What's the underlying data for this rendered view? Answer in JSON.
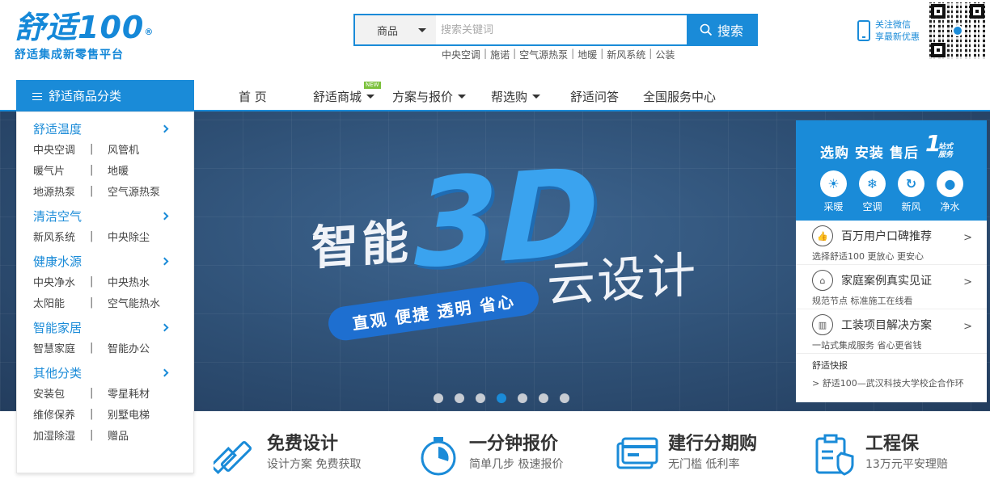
{
  "logo": {
    "main": "舒适100",
    "reg": "®",
    "slogan": "舒适集成新零售平台"
  },
  "search": {
    "category": "商品",
    "placeholder": "搜索关键词",
    "button": "搜索",
    "hot_links": [
      "中央空调",
      "施诺",
      "空气源热泵",
      "地暖",
      "新风系统",
      "公装"
    ]
  },
  "wechat": {
    "line1": "关注微信",
    "line2": "享最新优惠"
  },
  "nav": {
    "category_label": "舒适商品分类",
    "items": [
      "首 页",
      "舒适商城",
      "方案与报价",
      "帮选购",
      "舒适问答",
      "全国服务中心"
    ],
    "new_badge": "NEW"
  },
  "categories": [
    {
      "title": "舒适温度",
      "rows": [
        [
          "中央空调",
          "风管机"
        ],
        [
          "暖气片",
          "地暖"
        ],
        [
          "地源热泵",
          "空气源热泵"
        ]
      ]
    },
    {
      "title": "清洁空气",
      "rows": [
        [
          "新风系统",
          "中央除尘"
        ]
      ]
    },
    {
      "title": "健康水源",
      "rows": [
        [
          "中央净水",
          "中央热水"
        ],
        [
          "太阳能",
          "空气能热水"
        ]
      ]
    },
    {
      "title": "智能家居",
      "rows": [
        [
          "智慧家庭",
          "智能办公"
        ]
      ]
    },
    {
      "title": "其他分类",
      "rows": [
        [
          "安装包",
          "零星耗材"
        ],
        [
          "维修保养",
          "别墅电梯"
        ],
        [
          "加湿除湿",
          "赠品"
        ]
      ]
    }
  ],
  "banner": {
    "word1": "智能",
    "word2": "3D",
    "word3": "云设计",
    "pill": "直观 便捷 透明 省心",
    "dot_count": 7,
    "active_dot": 4
  },
  "right_panel": {
    "title": "选购 安装 售后",
    "badge_one": "1",
    "badge_l1": "站式",
    "badge_l2": "服务",
    "icons": [
      "采暖",
      "空调",
      "新风",
      "净水"
    ],
    "items": [
      {
        "title": "百万用户口碑推荐",
        "sub": "选择舒适100  更放心  更安心"
      },
      {
        "title": "家庭案例真实见证",
        "sub": "规范节点  标准施工在线看"
      },
      {
        "title": "工装项目解决方案",
        "sub": "一站式集成服务  省心更省钱"
      }
    ],
    "news_title": "舒适快报",
    "news": "> 舒适100—武汉科技大学校企合作环"
  },
  "features": [
    {
      "title": "免费设计",
      "sub": "设计方案  免费获取"
    },
    {
      "title": "一分钟报价",
      "sub": "简单几步  极速报价"
    },
    {
      "title": "建行分期购",
      "sub": "无门槛  低利率"
    },
    {
      "title": "工程保",
      "sub": "13万元平安理赔"
    }
  ],
  "colors": {
    "brand": "#1a8bd8",
    "banner_bg": "#2e4f74",
    "accent_3d": "#3aa3ef"
  }
}
